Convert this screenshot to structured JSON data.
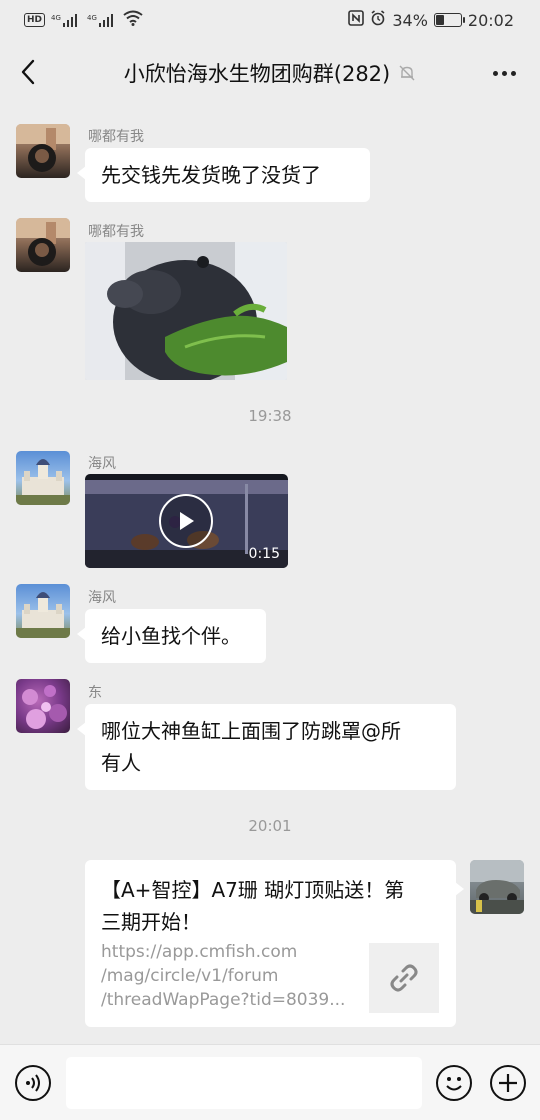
{
  "status_bar": {
    "hd": "HD",
    "signal_1": "4G",
    "signal_2": "4G",
    "battery_percent": "34%",
    "battery_level": 0.34,
    "time": "20:02"
  },
  "header": {
    "title": "小欣怡海水生物团购群(282)"
  },
  "messages": [
    {
      "type": "text",
      "sender": "哪都有我",
      "text": "先交钱先发货晚了没货了"
    },
    {
      "type": "image",
      "sender": "哪都有我"
    },
    {
      "type": "time",
      "text": "19:38"
    },
    {
      "type": "video",
      "sender": "海风",
      "duration": "0:15"
    },
    {
      "type": "text",
      "sender": "海风",
      "text": "给小鱼找个伴。"
    },
    {
      "type": "text",
      "sender": "东",
      "lines": [
        "哪位大神鱼缸上面围了防跳罩@所",
        "有人"
      ]
    },
    {
      "type": "time",
      "text": "20:01"
    },
    {
      "type": "link",
      "title_lines": [
        "【A+智控】A7珊 瑚灯顶贴送！第",
        "三期开始！"
      ],
      "url_lines": [
        "https://app.cmfish.com",
        "/mag/circle/v1/forum",
        "/threadWapPage?tid=8039..."
      ]
    }
  ],
  "colors": {
    "background": "#ededed",
    "bubble": "#ffffff",
    "muted_text": "#888888"
  },
  "icons": {
    "back": "chevron-left-icon",
    "mute": "bell-off-icon",
    "more": "more-dots-icon",
    "voice": "voice-icon",
    "emoji": "emoji-icon",
    "add": "plus-icon",
    "link": "link-icon",
    "play": "play-icon"
  }
}
